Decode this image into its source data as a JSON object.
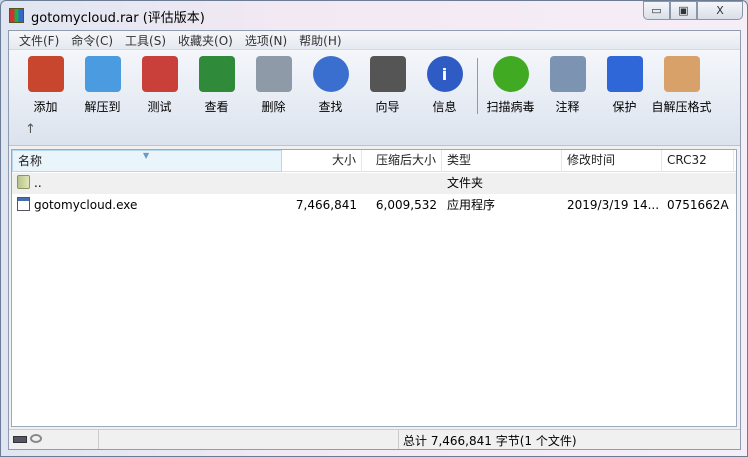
{
  "window": {
    "title": "gotomycloud.rar (评估版本)",
    "minimize": "▭",
    "maximize": "▣",
    "close": "X"
  },
  "menu": [
    "文件(F)",
    "命令(C)",
    "工具(S)",
    "收藏夹(O)",
    "选项(N)",
    "帮助(H)"
  ],
  "toolbar": [
    {
      "label": "添加",
      "icon": "add-archive-icon",
      "color": "#c8452e"
    },
    {
      "label": "解压到",
      "icon": "extract-folder-icon",
      "color": "#4a9be0"
    },
    {
      "label": "测试",
      "icon": "test-clipboard-icon",
      "color": "#c9403a"
    },
    {
      "label": "查看",
      "icon": "view-book-icon",
      "color": "#2f8a3a"
    },
    {
      "label": "删除",
      "icon": "trash-icon",
      "color": "#8e9aa8"
    },
    {
      "label": "查找",
      "icon": "find-magnifier-icon",
      "color": "#3b6fcf"
    },
    {
      "label": "向导",
      "icon": "wizard-wand-icon",
      "color": "#555555"
    },
    {
      "label": "信息",
      "icon": "info-icon",
      "color": "#2e5bc4"
    },
    {
      "label": "扫描病毒",
      "icon": "virus-scan-icon",
      "color": "#3faa22"
    },
    {
      "label": "注释",
      "icon": "comment-icon",
      "color": "#7d93b2"
    },
    {
      "label": "保护",
      "icon": "shield-icon",
      "color": "#2f66d8"
    },
    {
      "label": "自解压格式",
      "icon": "sfx-box-icon",
      "color": "#d9a16a"
    }
  ],
  "up_label": "↑",
  "columns": [
    "名称",
    "大小",
    "压缩后大小",
    "类型",
    "修改时间",
    "CRC32"
  ],
  "rows": [
    {
      "name": "..",
      "size": "",
      "packed": "",
      "type": "文件夹",
      "modified": "",
      "crc": ""
    },
    {
      "name": "gotomycloud.exe",
      "size": "7,466,841",
      "packed": "6,009,532",
      "type": "应用程序",
      "modified": "2019/3/19 14...",
      "crc": "0751662A"
    }
  ],
  "status": {
    "total": "总计 7,466,841 字节(1 个文件)"
  }
}
